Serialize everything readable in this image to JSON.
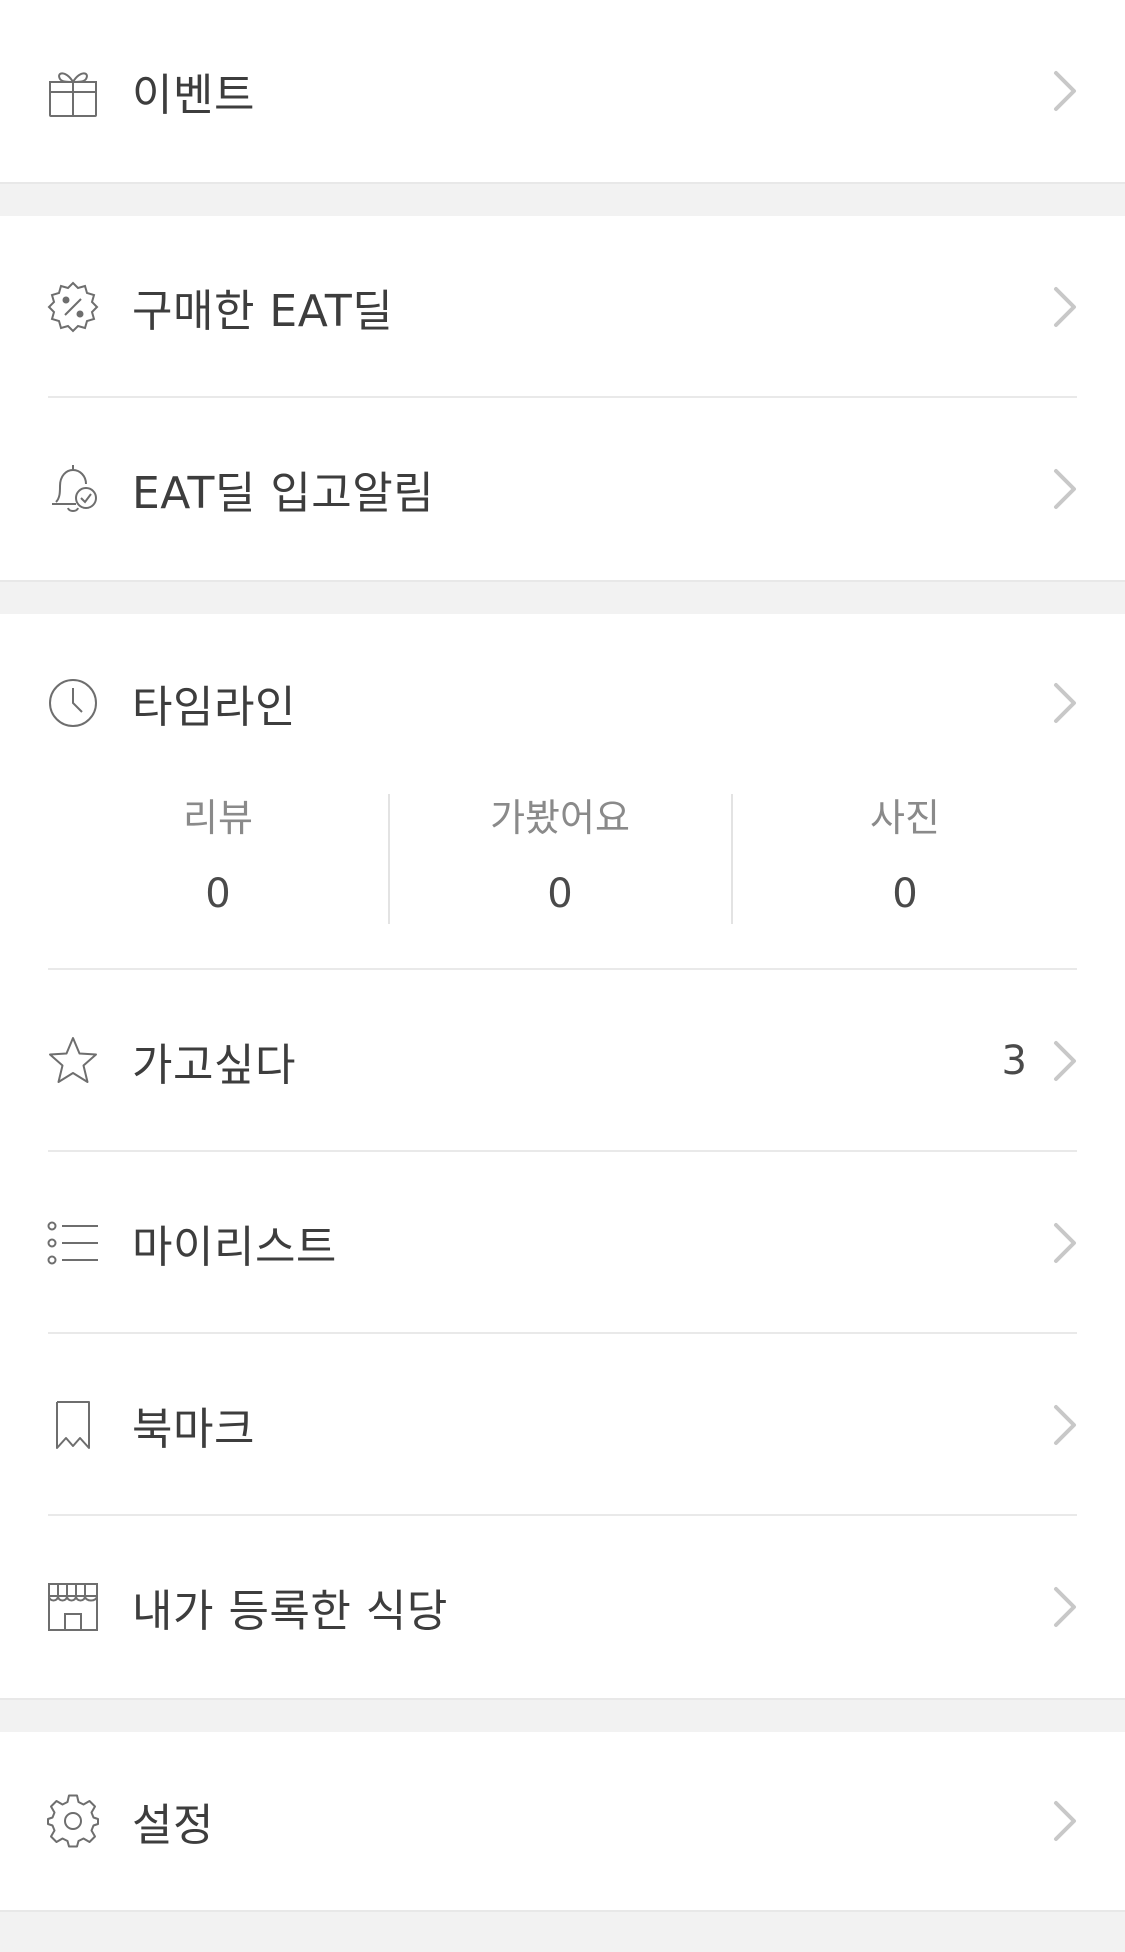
{
  "menu": {
    "event": {
      "label": "이벤트",
      "icon": "gift-icon"
    },
    "purchased_deal": {
      "label": "구매한 EAT딜",
      "icon": "discount-badge-icon"
    },
    "deal_alert": {
      "label": "EAT딜 입고알림",
      "icon": "bell-check-icon"
    },
    "timeline": {
      "label": "타임라인",
      "icon": "clock-icon"
    },
    "want_to_go": {
      "label": "가고싶다",
      "icon": "star-icon",
      "count": "3"
    },
    "my_list": {
      "label": "마이리스트",
      "icon": "list-icon"
    },
    "bookmark": {
      "label": "북마크",
      "icon": "bookmark-icon"
    },
    "my_restaurants": {
      "label": "내가 등록한 식당",
      "icon": "store-icon"
    },
    "settings": {
      "label": "설정",
      "icon": "gear-icon"
    }
  },
  "timeline_stats": [
    {
      "label": "리뷰",
      "value": "0"
    },
    {
      "label": "가봤어요",
      "value": "0"
    },
    {
      "label": "사진",
      "value": "0"
    }
  ],
  "colors": {
    "icon_stroke": "#6e6e6e",
    "chevron": "#c8c8c8",
    "divider": "#e9e9e9",
    "section_gap": "#f2f2f2"
  }
}
